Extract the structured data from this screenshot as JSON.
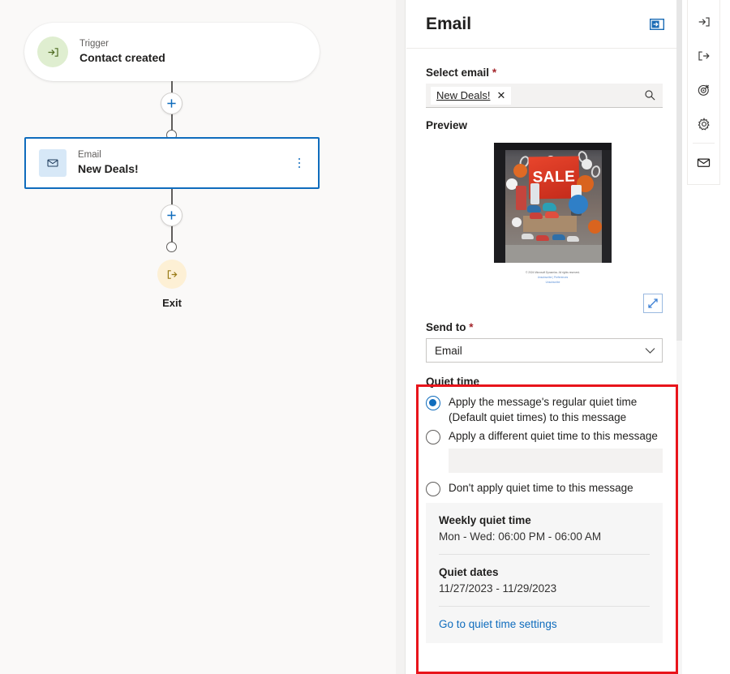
{
  "canvas": {
    "trigger_node": {
      "kicker": "Trigger",
      "title": "Contact created",
      "icon": "enter-arrow-icon"
    },
    "email_node": {
      "kicker": "Email",
      "title": "New Deals!",
      "icon": "envelope-icon",
      "menu_icon": "more-vertical-icon"
    },
    "add_step_label": "+",
    "exit_node": {
      "label": "Exit",
      "icon": "exit-arrow-icon"
    }
  },
  "panel": {
    "title": "Email",
    "header_button_icon": "panel-expand-icon",
    "select_email": {
      "label": "Select email",
      "required_marker": "*",
      "token": "New Deals!",
      "remove_icon": "close-icon",
      "search_icon": "search-icon"
    },
    "preview": {
      "label": "Preview",
      "image_alt": "SALE",
      "sale_text": "SALE",
      "footer_line1": "© 2024 Microsoft Dynamics. All rights reserved.",
      "footer_line2": "Unsubscribe | Preferences",
      "footer_link": "Unsubscribe",
      "expand_icon": "expand-diagonal-icon"
    },
    "send_to": {
      "label": "Send to",
      "required_marker": "*",
      "value": "Email",
      "chevron_icon": "chevron-down-icon",
      "options": [
        "Email"
      ]
    },
    "quiet_time": {
      "heading": "Quiet time",
      "options": [
        {
          "label": "Apply the message's regular quiet time (Default quiet times) to this message",
          "selected": true
        },
        {
          "label": "Apply a different quiet time to this message",
          "selected": false
        },
        {
          "label": "Don't apply quiet time to this message",
          "selected": false
        }
      ],
      "info": {
        "weekly_title": "Weekly quiet time",
        "weekly_value": "Mon - Wed: 06:00 PM - 06:00 AM",
        "dates_title": "Quiet dates",
        "dates_value": "11/27/2023 - 11/29/2023",
        "settings_link": "Go to quiet time settings"
      }
    }
  },
  "rail": {
    "items": [
      {
        "name": "trigger-icon"
      },
      {
        "name": "exit-icon"
      },
      {
        "name": "target-goal-icon"
      },
      {
        "name": "settings-gear-icon"
      },
      {
        "name": "email-icon"
      }
    ]
  },
  "colors": {
    "accent": "#0f6cbd",
    "highlight": "#e8141b",
    "required": "#a4262c",
    "canvas_bg": "#faf9f8",
    "trigger_icon_bg": "#dfeed0",
    "exit_icon_bg": "#fdf0d5",
    "email_icon_bg": "#d7e8f7"
  }
}
